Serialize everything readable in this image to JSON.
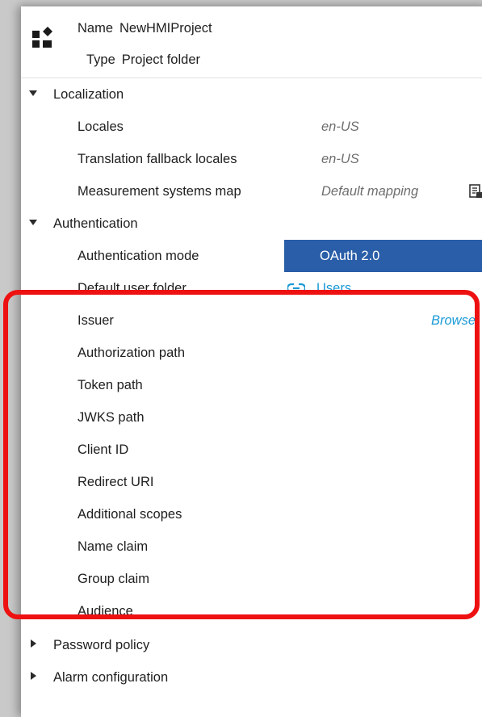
{
  "header": {
    "name_key": "Name",
    "name_value": "NewHMIProject",
    "type_key": "Type",
    "type_value": "Project folder",
    "icon": "project-folder-icon"
  },
  "sections": {
    "localization": {
      "label": "Localization",
      "expanded": true,
      "locales_label": "Locales",
      "locales_value": "en-US",
      "fallback_label": "Translation fallback locales",
      "fallback_value": "en-US",
      "measurement_label": "Measurement systems map",
      "measurement_value": "Default mapping",
      "measurement_icon": "document-list-icon"
    },
    "authentication": {
      "label": "Authentication",
      "expanded": true,
      "mode_label": "Authentication mode",
      "mode_value": "OAuth 2.0",
      "user_folder_label": "Default user folder",
      "user_folder_value": "Users",
      "user_folder_icon": "link-icon",
      "browse_label": "Browse",
      "oauth_fields": [
        "Issuer",
        "Authorization path",
        "Token path",
        "JWKS path",
        "Client ID",
        "Redirect URI",
        "Additional scopes",
        "Name claim",
        "Group claim",
        "Audience"
      ]
    },
    "password_policy": {
      "label": "Password policy",
      "expanded": false
    },
    "alarm_configuration": {
      "label": "Alarm configuration",
      "expanded": false
    }
  },
  "colors": {
    "selection": "#2a5ea8",
    "link": "#1b9ad6",
    "highlight": "#ee1111"
  }
}
